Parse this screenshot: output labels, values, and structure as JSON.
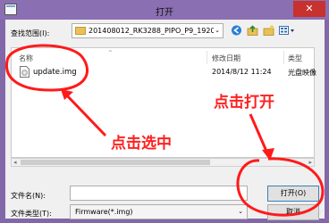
{
  "window": {
    "title": "打开",
    "close_symbol": "✕"
  },
  "toolbar": {
    "lookin_label": "查找范围(I):",
    "lookin_value": "201408012_RK3288_PIPO_P9_1920",
    "combo_arrow": "⌄",
    "icons": [
      "back-icon",
      "up-folder-icon",
      "new-folder-icon",
      "view-menu-icon"
    ]
  },
  "filelist": {
    "columns": [
      "名称",
      "修改日期",
      "类型"
    ],
    "files": [
      {
        "name": "update.img",
        "modified": "2014/8/12 11:24",
        "type": "光盘映像"
      }
    ]
  },
  "form": {
    "filename_label": "文件名(N):",
    "filename_value": "",
    "filetype_label": "文件类型(T):",
    "filetype_value": "Firmware(*.img)",
    "open_button": "打开(O)",
    "cancel_button": "取消"
  },
  "annotations": {
    "select_text": "点击选中",
    "open_text": "点击打开",
    "color": "#ff1a1a"
  }
}
